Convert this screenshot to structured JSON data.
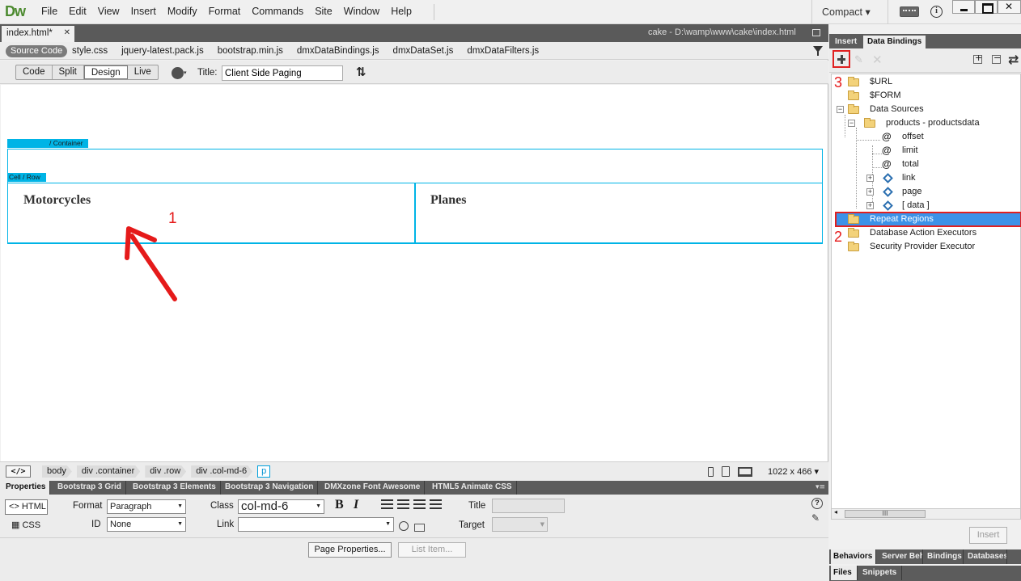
{
  "app": {
    "logo": "Dw",
    "menu": [
      "File",
      "Edit",
      "View",
      "Insert",
      "Modify",
      "Format",
      "Commands",
      "Site",
      "Window",
      "Help"
    ],
    "workspace": "Compact ▾",
    "info_icon": "i"
  },
  "document": {
    "tab_label": "index.html*",
    "tab_close": "✕",
    "path": "cake - D:\\wamp\\www\\cake\\index.html",
    "source_code_label": "Source Code",
    "related_files": [
      "style.css",
      "jquery-latest.pack.js",
      "bootstrap.min.js",
      "dmxDataBindings.js",
      "dmxDataSet.js",
      "dmxDataFilters.js"
    ]
  },
  "viewbar": {
    "modes": [
      "Code",
      "Split",
      "Design",
      "Live"
    ],
    "active_mode": "Design",
    "title_label": "Title:",
    "title_value": "Client Side Paging",
    "sort_icon": "⇅"
  },
  "design": {
    "container_tag": "/ Container",
    "row_tag": "Cell / Row",
    "col1_heading": "Motorcycles",
    "col2_heading": "Planes",
    "annotation_1": "1"
  },
  "tag_selector": {
    "code_icon": "</>",
    "crumbs": [
      "body",
      "div .container",
      "div .row",
      "div .col-md-6"
    ],
    "current": "p",
    "dimensions": "1022 x 466 ▾"
  },
  "properties": {
    "tabs": [
      "Properties",
      "Bootstrap 3 Grid",
      "Bootstrap 3 Elements",
      "Bootstrap 3 Navigation",
      "DMXzone Font Awesome",
      "HTML5 Animate CSS"
    ],
    "html_btn": "<> HTML",
    "css_btn": "CSS",
    "format_label": "Format",
    "format_value": "Paragraph",
    "class_label": "Class",
    "class_value": "col-md-6",
    "id_label": "ID",
    "id_value": "None",
    "link_label": "Link",
    "link_value": "",
    "bold": "B",
    "italic": "I",
    "title_label": "Title",
    "target_label": "Target",
    "help_icon": "?",
    "page_properties_btn": "Page Properties...",
    "list_item_btn": "List Item..."
  },
  "right_panel": {
    "tabs": [
      "Insert",
      "Data Bindings"
    ],
    "active_tab": "Data Bindings",
    "refresh_icon": "⇄",
    "tree": {
      "url": "$URL",
      "form": "$FORM",
      "data_sources": "Data Sources",
      "products": "products - productsdata",
      "offset": "offset",
      "limit": "limit",
      "total": "total",
      "link": "link",
      "page": "page",
      "data": "[ data ]",
      "repeat_regions": "Repeat Regions",
      "db_action_executors": "Database Action Executors",
      "security_provider": "Security Provider Executor"
    },
    "annotation_2": "2",
    "annotation_3": "3",
    "scroll_thumb": "III",
    "insert_btn": "Insert",
    "bottom_tabs_1": [
      "Behaviors",
      "Server Beh",
      "Bindings",
      "Databases"
    ],
    "bottom_tabs_2": [
      "Files",
      "Snippets"
    ]
  },
  "colors": {
    "accent_cyan": "#00b4e6",
    "annotation_red": "#e51a1a",
    "selection_blue": "#3c92e8"
  }
}
